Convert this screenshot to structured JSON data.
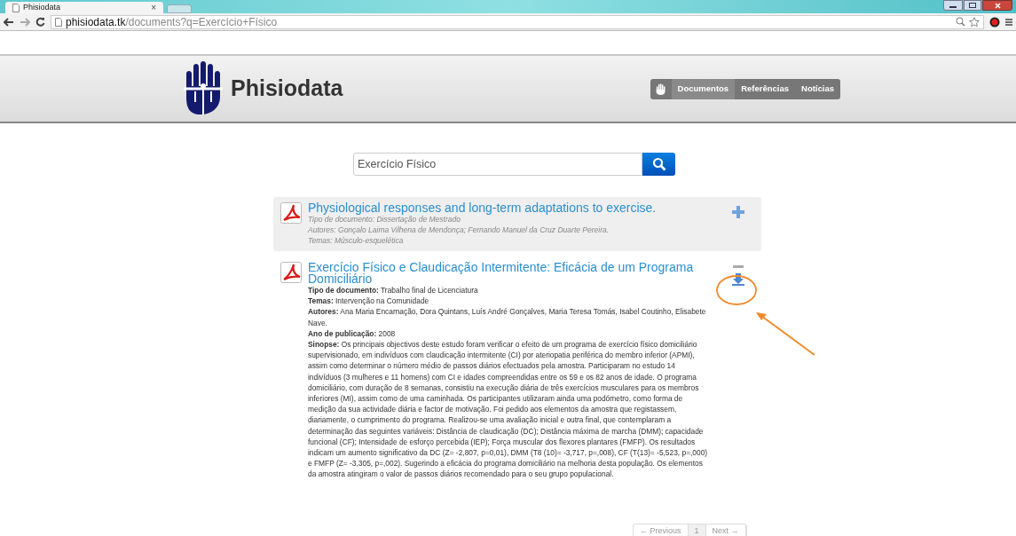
{
  "browser": {
    "tab_title": "Phisiodata",
    "tab_close": "×",
    "url_host": "phisiodata.tk",
    "url_path": "/documents?q=Exercício+Físico"
  },
  "site": {
    "title": "Phisiodata",
    "nav": [
      {
        "label": "Documentos",
        "selected": true
      },
      {
        "label": "Referências",
        "selected": false
      },
      {
        "label": "Notícias",
        "selected": false
      }
    ]
  },
  "search": {
    "value": "Exercício Físico"
  },
  "results": [
    {
      "title": "Physiological responses and long-term adaptations to exercise.",
      "expanded": false,
      "meta": [
        "Tipo de documento: Dissertação de Mestrado",
        "Autores: Gonçalo Laima Vilhena de Mendonça; Fernando Manuel da Cruz Duarte Pereira.",
        "Temas: Músculo-esquelética"
      ]
    },
    {
      "title": "Exercício Físico e Claudicação Intermitente: Eficácia de um Programa Domiciliário",
      "expanded": true,
      "fields": [
        "**Tipo de documento:** Trabalho final de Licenciatura",
        "**Temas:** Intervenção na Comunidade",
        "**Autores:** Ana Maria Encarnação, Dora Quintans, Luís André Gonçalves, Maria Teresa Tomás, Isabel Coutinho, Elisabete Nave.",
        "**Ano de publicação:** 2008",
        "**Sinopse:** Os principais objectivos deste estudo foram verificar o efeito de um programa de exercício físico domiciliário supervisionado, em indivíduos com claudicação intermitente (CI) por ateriopatia periférica do membro inferior (APMI), assim como determinar o número médio de passos diários efectuados pela amostra. Participaram no estudo 14 indivíduos (3 mulheres e 11 homens) com CI e idades compreendidas entre os 59 e os 82 anos de idade. O programa domiciliário, com duração de 8 semanas, consistiu na execução diária de três exercícios musculares para os membros inferiores (MI), assim como de uma caminhada. Os participantes utilizaram ainda uma podómetro, como forma de medição da sua actividade diária e factor de motivação. Foi pedido aos elementos da amostra que registassem, diariamente, o cumprimento do programa. Realizou-se uma avaliação inicial e outra final, que contemplaram a determinação das seguintes variáveis: Distância de claudicação (DC); Distância máxima de marcha (DMM); capacidade funcional (CF); Intensidade de esforço percebida (IEP); Força muscular dos flexores plantares (FMFP). Os resultados indicam um aumento significativo da DC (Z= -2,807, p=0,01), DMM (T8 (10)= -3,717, p=,008), CF (T(13)= -5,523, p=,000) e FMFP (Z= -3,305, p=,002). Sugerindo a eficácia do programa domiciliário na melhoria desta população. Os elementos da amostra atingiram o valor de passos diários recomendado para o seu grupo populacional."
      ]
    }
  ],
  "pagination": [
    {
      "label": "← Previous",
      "selected": false
    },
    {
      "label": "1",
      "selected": true
    },
    {
      "label": "Next →",
      "selected": false
    }
  ]
}
